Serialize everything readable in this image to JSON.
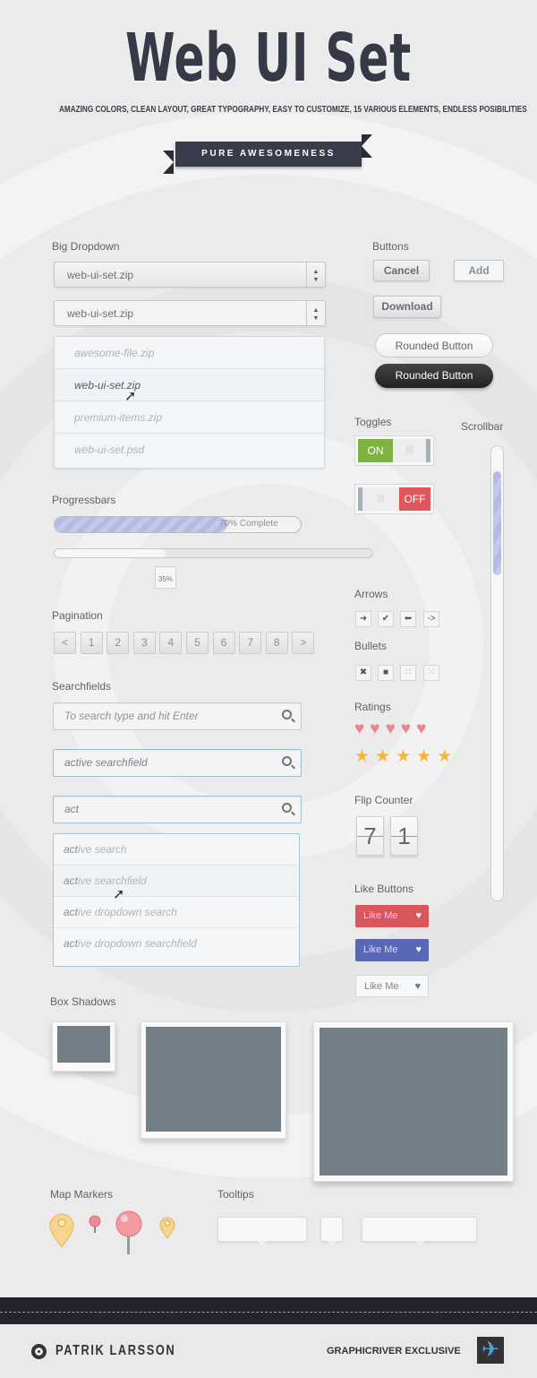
{
  "header": {
    "title": "Web UI Set",
    "subtitle": "AMAZING COLORS, CLEAN LAYOUT, GREAT TYPOGRAPHY, EASY TO CUSTOMIZE, 15 VARIOUS ELEMENTS, ENDLESS POSIBILITIES",
    "ribbon": "PURE AWESOMENESS"
  },
  "dropdown": {
    "label": "Big Dropdown",
    "value1": "web-ui-set.zip",
    "value2": "web-ui-set.zip",
    "options": [
      "awesome-file.zip",
      "web-ui-set.zip",
      "premium-items.zip",
      "web-ui-set.psd"
    ],
    "hovered": 1
  },
  "progress": {
    "label": "Progressbars",
    "bar_text": "70% Complete",
    "bar_value": 70,
    "slider_value": 35,
    "slider_text": "35%"
  },
  "pagination": {
    "label": "Pagination",
    "items": [
      "<",
      "1",
      "2",
      "3",
      "4",
      "5",
      "6",
      "7",
      "8",
      ">"
    ]
  },
  "search": {
    "label": "Searchfields",
    "placeholder": "To search type and hit Enter",
    "active_value": "active searchfield",
    "typed": "act",
    "suggestions": [
      {
        "match": "act",
        "rest": "ive search"
      },
      {
        "match": "act",
        "rest": "ive searchfield"
      },
      {
        "match": "act",
        "rest": "ive dropdown search"
      },
      {
        "match": "act",
        "rest": "ive dropdown searchfield"
      }
    ]
  },
  "buttons": {
    "label": "Buttons",
    "cancel": "Cancel",
    "add": "Add",
    "download": "Download",
    "rounded_light": "Rounded Button",
    "rounded_dark": "Rounded Button"
  },
  "toggles": {
    "label": "Toggles",
    "on": "ON",
    "off": "OFF",
    "on_color": "#7cb342",
    "off_color": "#e0575b"
  },
  "scrollbar": {
    "label": "Scrollbar"
  },
  "arrows": {
    "label": "Arrows",
    "icons": [
      "arrow-right",
      "check",
      "arrow-left",
      "dash-arrow"
    ],
    "glyphs": [
      "➜",
      "✔",
      "⬅",
      "->"
    ]
  },
  "bullets": {
    "label": "Bullets",
    "icons": [
      "cross",
      "square",
      "dots",
      "scatter"
    ],
    "glyphs": [
      "✖",
      "■",
      "∷",
      "⁙"
    ]
  },
  "ratings": {
    "label": "Ratings",
    "hearts": 5,
    "stars": 5,
    "heart_color": "#e8868c",
    "star_color": "#f5b633"
  },
  "flip_counter": {
    "label": "Flip Counter",
    "digits": [
      "7",
      "1"
    ]
  },
  "like": {
    "label": "Like Buttons",
    "red": "Like Me",
    "blue": "Like Me",
    "plain": "Like Me",
    "red_color": "#d9575a",
    "blue_color": "#5a67b8"
  },
  "box_shadows": {
    "label": "Box Shadows"
  },
  "map_markers": {
    "label": "Map Markers"
  },
  "tooltips": {
    "label": "Tooltips"
  },
  "footer": {
    "author": "PATRIK LARSSON",
    "badge": "GRAPHICRIVER EXCLUSIVE"
  }
}
